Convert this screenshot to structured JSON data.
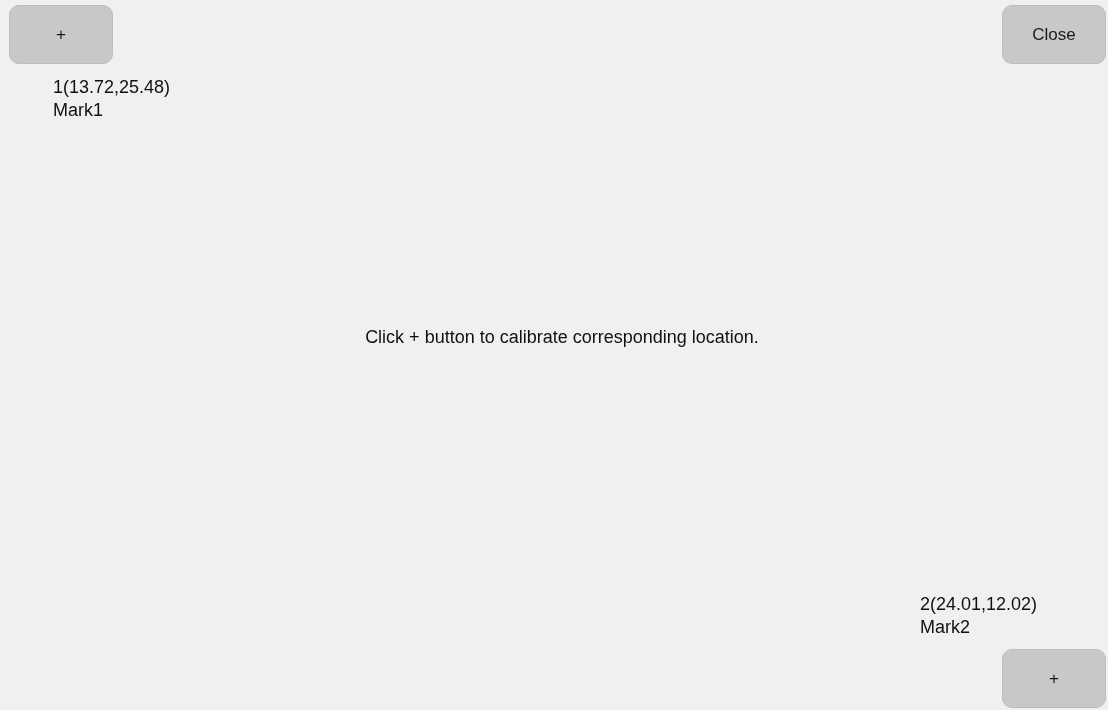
{
  "marks": [
    {
      "add_button": "+",
      "coordinates": "1(13.72,25.48)",
      "name": "Mark1"
    },
    {
      "add_button": "+",
      "coordinates": "2(24.01,12.02)",
      "name": "Mark2"
    }
  ],
  "close_button": "Close",
  "instruction": "Click + button to calibrate corresponding location."
}
